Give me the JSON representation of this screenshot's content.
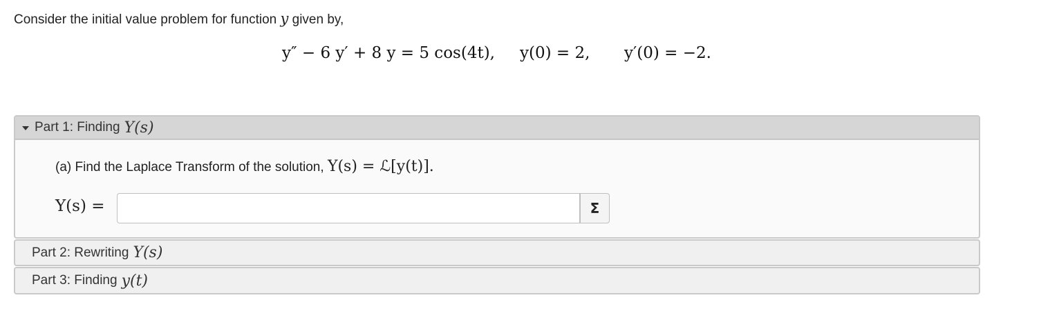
{
  "intro": {
    "text_before": "Consider the initial value problem for function ",
    "variable": "y",
    "text_after": " given by,"
  },
  "equation": {
    "ode": "y″ − 6 y′ + 8 y = 5 cos(4t),",
    "ic1": "y(0) = 2,",
    "ic2": "y′(0) = −2."
  },
  "parts": [
    {
      "label": "Part 1: Finding",
      "math": "Y(s)",
      "expanded": true,
      "question_text": "(a) Find the Laplace Transform of the solution, ",
      "question_math": "Y(s) = ℒ[y(t)].",
      "answer_label": "Y(s) =",
      "answer_value": "",
      "answer_placeholder": "",
      "sigma_icon": "Σ"
    },
    {
      "label": "Part 2: Rewriting",
      "math": "Y(s)",
      "expanded": false
    },
    {
      "label": "Part 3: Finding",
      "math": "y(t)",
      "expanded": false
    }
  ]
}
